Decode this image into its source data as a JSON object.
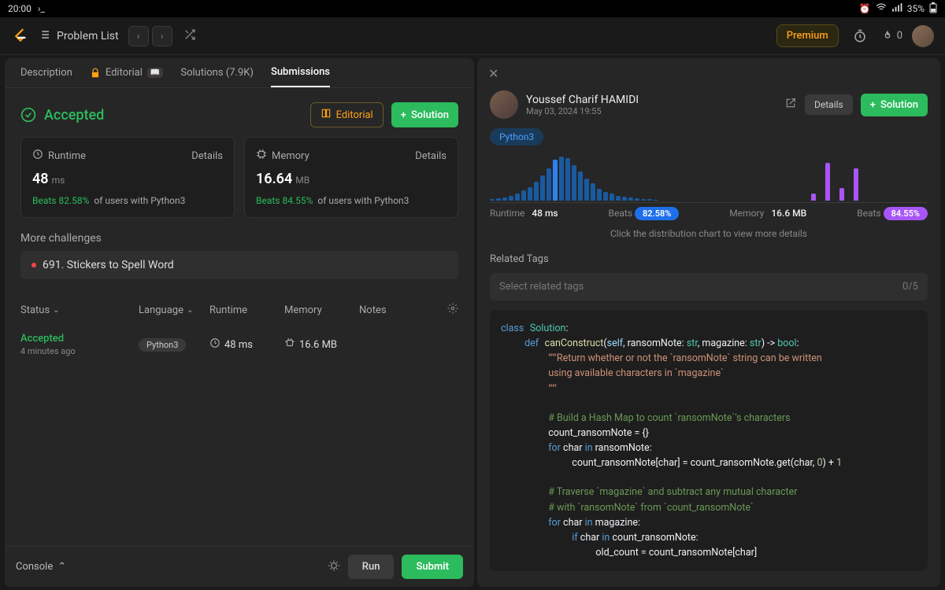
{
  "statusbar": {
    "time": "20:00",
    "battery": "35%"
  },
  "topbar": {
    "problem_list": "Problem List",
    "premium": "Premium",
    "streak_count": "0"
  },
  "tabs": {
    "description": "Description",
    "editorial": "Editorial",
    "solutions": "Solutions (7.9K)",
    "submissions": "Submissions"
  },
  "accepted": {
    "status": "Accepted",
    "editorial_btn": "Editorial",
    "solution_btn": "Solution"
  },
  "runtime_card": {
    "label": "Runtime",
    "details": "Details",
    "value": "48",
    "unit": "ms",
    "beats_label": "Beats",
    "beats_pct": "82.58%",
    "beats_suffix": "of users with Python3"
  },
  "memory_card": {
    "label": "Memory",
    "details": "Details",
    "value": "16.64",
    "unit": "MB",
    "beats_label": "Beats",
    "beats_pct": "84.55%",
    "beats_suffix": "of users with Python3"
  },
  "more_challenges": {
    "heading": "More challenges",
    "item": "691. Stickers to Spell Word"
  },
  "table": {
    "status": "Status",
    "language": "Language",
    "runtime": "Runtime",
    "memory": "Memory",
    "notes": "Notes",
    "row": {
      "status": "Accepted",
      "age": "4 minutes ago",
      "lang": "Python3",
      "runtime": "48 ms",
      "memory": "16.6 MB"
    }
  },
  "footer": {
    "console": "Console",
    "run": "Run",
    "submit": "Submit"
  },
  "detail": {
    "author": "Youssef Charif HAMIDI",
    "date": "May 03, 2024 19:55",
    "details_btn": "Details",
    "solution_btn": "Solution",
    "lang": "Python3",
    "runtime_label": "Runtime",
    "runtime_val": "48 ms",
    "beats1_label": "Beats",
    "beats1_val": "82.58%",
    "memory_label": "Memory",
    "memory_val": "16.6 MB",
    "beats2_label": "Beats",
    "beats2_val": "84.55%",
    "chart_hint": "Click the distribution chart to view more details",
    "related_tags": "Related Tags",
    "tags_placeholder": "Select related tags",
    "tags_count": "0/5"
  },
  "chart_data": {
    "type": "bar",
    "series": [
      {
        "name": "Runtime distribution",
        "color": "#1a5aa0",
        "values": [
          2,
          3,
          4,
          6,
          8,
          12,
          16,
          22,
          30,
          38,
          48,
          52,
          50,
          42,
          34,
          26,
          20,
          14,
          10,
          8,
          6,
          5,
          4,
          3,
          2,
          2,
          1
        ],
        "highlight_index": 10
      },
      {
        "name": "Memory distribution",
        "color": "#a855f7",
        "values": [
          8,
          42,
          14,
          36
        ]
      }
    ],
    "runtime_label": "Runtime 48 ms",
    "memory_label": "Memory 16.6 MB",
    "beats_runtime": "82.58%",
    "beats_memory": "84.55%"
  },
  "code": {
    "l1a": "class",
    "l1b": "Solution",
    "l1c": ":",
    "l2a": "def",
    "l2b": "canConstruct",
    "l2c": "(",
    "l2d": "self",
    "l2e": ", ransomNote: ",
    "l2f": "str",
    "l2g": ", magazine: ",
    "l2h": "str",
    "l2i": ") -> ",
    "l2j": "bool",
    "l2k": ":",
    "l3": "\"\"\"Return whether or not the `ransomNote` string can be written",
    "l4": "using available characters in `magazine`",
    "l5": "\"\"\"",
    "l6": "# Build a Hash Map to count `ransomNote`'s characters",
    "l7": "count_ransomNote = {}",
    "l8a": "for",
    "l8b": " char ",
    "l8c": "in",
    "l8d": " ransomNote:",
    "l9a": "count_ransomNote[char] = count_ransomNote.get(char, ",
    "l9b": "0",
    "l9c": ") + ",
    "l9d": "1",
    "l10": "# Traverse `magazine` and subtract any mutual character",
    "l11": "# with `ransomNote` from `count_ransomNote`",
    "l12a": "for",
    "l12b": " char ",
    "l12c": "in",
    "l12d": " magazine:",
    "l13a": "if",
    "l13b": " char ",
    "l13c": "in",
    "l13d": " count_ransomNote:",
    "l14": "old_count = count_ransomNote[char]"
  }
}
